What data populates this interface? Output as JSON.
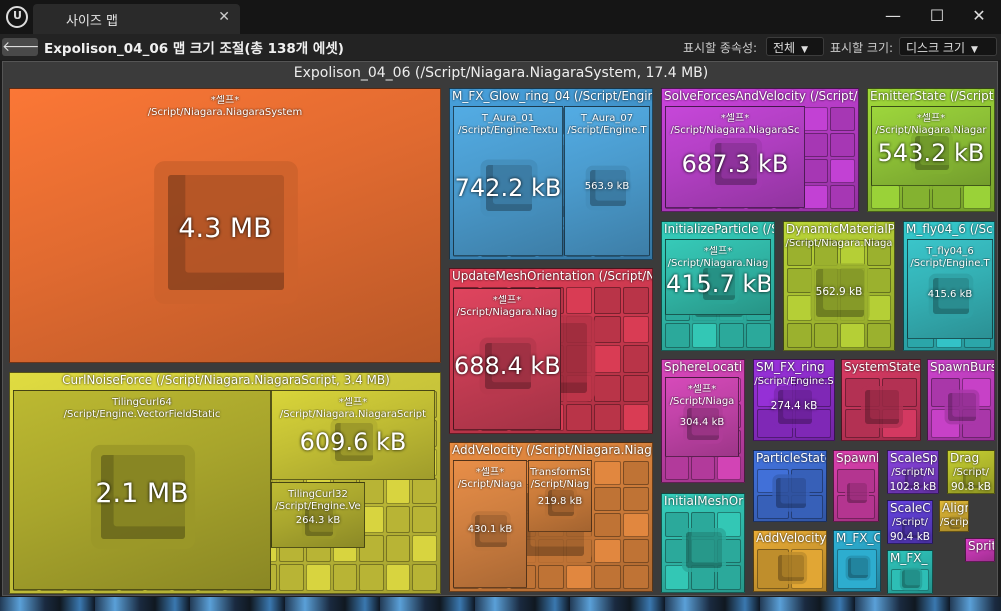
{
  "window": {
    "tab_title": "사이즈 맵",
    "close_glyph": "✕",
    "logo_glyph": "U",
    "min_glyph": "—",
    "max_glyph": "☐",
    "win_close_glyph": "✕"
  },
  "toolbar": {
    "back_glyph": "🡐",
    "title": "Expolison_04_06 맵 크기 조절(총 138개 에셋)",
    "dependency_label": "표시할 종속성:",
    "dependency_value": "전체",
    "size_label": "표시할 크기:",
    "size_value": "디스크 크기"
  },
  "map": {
    "root_title": "Expolison_04_06  (/Script/Niagara.NiagaraSystem, 17.4 MB)",
    "nodes": [
      {
        "id": "self-root",
        "color": "#e06a30",
        "title": "",
        "lines": [
          "*셀프*",
          "/Script/Niagara.NiagaraSystem"
        ],
        "size": "4.3 MB"
      },
      {
        "id": "curl",
        "color": "#c8c43a",
        "title": "CurlNoiseForce  (/Script/Niagara.NiagaraScript, 3.4 MB)"
      },
      {
        "id": "tiling64",
        "color": "#a8a52c",
        "lines": [
          "TilingCurl64",
          "/Script/Engine.VectorFieldStatic"
        ],
        "size": "2.1 MB"
      },
      {
        "id": "curl-self",
        "color": "#c2be34",
        "lines": [
          "*셀프*",
          "/Script/Niagara.NiagaraScript"
        ],
        "size": "609.6 kB"
      },
      {
        "id": "tiling32",
        "color": "#aaa72e",
        "lines": [
          "TilingCurl32",
          "/Script/Engine.Ve"
        ],
        "size": "264.3 kB"
      },
      {
        "id": "glow",
        "color": "#3f8fc4",
        "title": "M_FX_Glow_ring_04  (/Script/Engin"
      },
      {
        "id": "aura01",
        "color": "#4a9acc",
        "lines": [
          "T_Aura_01",
          "/Script/Engine.Textu"
        ],
        "size": "742.2 kB"
      },
      {
        "id": "aura07",
        "color": "#4a9acc",
        "lines": [
          "T_Aura_07",
          "/Script/Engine.T"
        ],
        "size": "563.9 kB"
      },
      {
        "id": "updatemesh",
        "color": "#c9384e",
        "title": "UpdateMeshOrientation  (/Script/Ni"
      },
      {
        "id": "updatemesh-self",
        "color": "#c73d54",
        "lines": [
          "*셀프*",
          "/Script/Niagara.Niag"
        ],
        "size": "688.4 kB"
      },
      {
        "id": "addvel",
        "color": "#d07d3a",
        "title": "AddVelocity  (/Script/Niagara.Niaga"
      },
      {
        "id": "addvel-self",
        "color": "#cf7f40",
        "lines": [
          "*셀프*",
          "/Script/Niaga"
        ],
        "size": "430.1 kB"
      },
      {
        "id": "transform",
        "color": "#c87a3a",
        "lines": [
          "TransformSt",
          "/Script/Niag"
        ],
        "size": "219.8 kB"
      },
      {
        "id": "solve",
        "color": "#b43cc4",
        "title": "SolveForcesAndVelocity  (/Script/"
      },
      {
        "id": "solve-self",
        "color": "#b13fc2",
        "lines": [
          "*셀프*",
          "/Script/Niagara.NiagaraSc"
        ],
        "size": "687.3 kB"
      },
      {
        "id": "emitter",
        "color": "#8fc234",
        "title": "EmitterState  (/Script"
      },
      {
        "id": "emitter-self",
        "color": "#8cbf36",
        "lines": [
          "*셀프*",
          "/Script/Niagara.Niagar"
        ],
        "size": "543.2 kB"
      },
      {
        "id": "initpart",
        "color": "#2fb8a8",
        "title": "InitializeParticle  (/S"
      },
      {
        "id": "initpart-self",
        "color": "#30b4a4",
        "lines": [
          "*셀프*",
          "/Script/Niagara.Niag"
        ],
        "size": "415.7 kB"
      },
      {
        "id": "dynmat",
        "color": "#a8c032",
        "title": "DynamicMaterialP",
        "lines": [
          "/Script/Niagara.Niaga"
        ],
        "size": "562.9 kB"
      },
      {
        "id": "fly",
        "color": "#2fb4b8",
        "title": "M_fly04_6  (/Sc"
      },
      {
        "id": "fly-tex",
        "color": "#34b0b4",
        "lines": [
          "T_fly04_6",
          "/Script/Engine.T"
        ],
        "size": "415.6 kB"
      },
      {
        "id": "sphere",
        "color": "#c23fa8",
        "title": "SphereLocati"
      },
      {
        "id": "sphere-self",
        "color": "#bf42a6",
        "lines": [
          "*셀프*",
          "/Script/Niaga"
        ],
        "size": "304.4 kB"
      },
      {
        "id": "smfx",
        "color": "#8a2cc6",
        "title": "SM_FX_ring",
        "lines": [
          "/Script/Engine.S"
        ],
        "size": "274.4 kB"
      },
      {
        "id": "sysstate",
        "color": "#c3355a",
        "title": "SystemState"
      },
      {
        "id": "spawnburst",
        "color": "#b83cb8",
        "title": "SpawnBurs"
      },
      {
        "id": "partstate",
        "color": "#3c68c8",
        "title": "ParticleState"
      },
      {
        "id": "spawnr",
        "color": "#c43a9c",
        "title": "SpawnR"
      },
      {
        "id": "scalesp",
        "color": "#7a3cc8",
        "title": "ScaleSp",
        "lines": [
          "/Script/N"
        ],
        "size": "102.8 kB"
      },
      {
        "id": "drag",
        "color": "#b0b82c",
        "title": "Drag",
        "lines": [
          "/Script/"
        ],
        "size": "90.8 kB"
      },
      {
        "id": "initmesh",
        "color": "#2fb8a8",
        "title": "InitialMeshOr"
      },
      {
        "id": "addvel2",
        "color": "#d09a30",
        "title": "AddVelocity"
      },
      {
        "id": "mfxc",
        "color": "#2aa0c0",
        "title": "M_FX_C"
      },
      {
        "id": "scalec",
        "color": "#5a3cc8",
        "title": "ScaleC",
        "lines": [
          "/Script/"
        ],
        "size": "90.4 kB"
      },
      {
        "id": "align",
        "color": "#c8a430",
        "title": "Align",
        "lines": [
          "/Scrip"
        ]
      },
      {
        "id": "mfx",
        "color": "#2ab0a8",
        "title": "M_FX_"
      },
      {
        "id": "sprite",
        "color": "#c238b0",
        "title": "Sprit"
      }
    ]
  }
}
